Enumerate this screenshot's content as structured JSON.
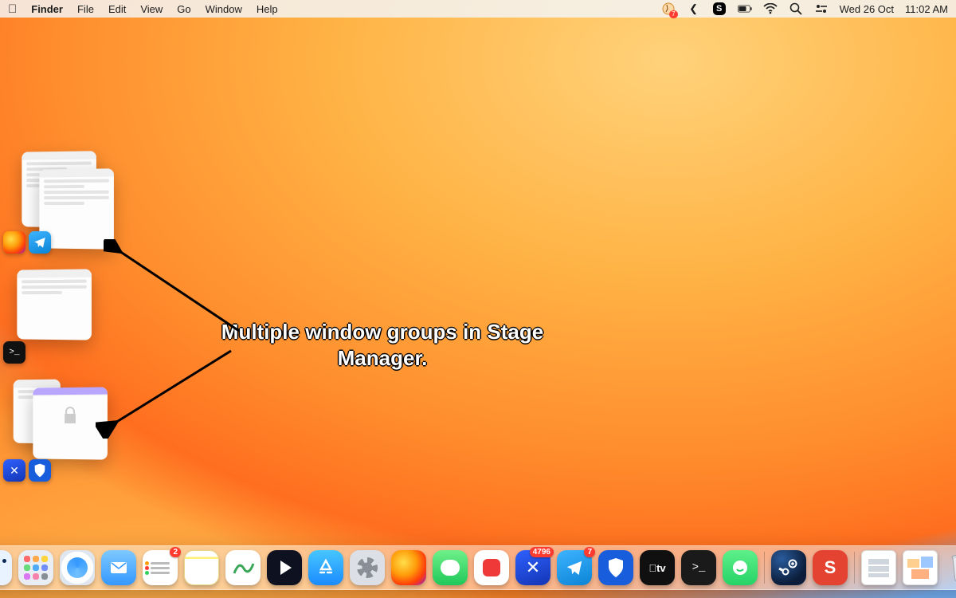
{
  "menubar": {
    "app_name": "Finder",
    "menus": [
      "File",
      "Edit",
      "View",
      "Go",
      "Window",
      "Help"
    ],
    "status": {
      "skype_badge": "S",
      "todoist_badge": "7",
      "date": "Wed 26 Oct",
      "time": "11:02 AM"
    }
  },
  "stage_manager": {
    "groups": [
      {
        "name": "group-firefox-telegram",
        "apps": [
          "Firefox",
          "Telegram"
        ]
      },
      {
        "name": "group-terminal",
        "apps": [
          "Terminal"
        ]
      },
      {
        "name": "group-tool-bitwarden",
        "apps": [
          "Tool",
          "Bitwarden"
        ]
      }
    ]
  },
  "annotation": {
    "text": "Multiple window groups in Stage Manager."
  },
  "dock": {
    "items": [
      {
        "name": "Finder",
        "class": "finder"
      },
      {
        "name": "Launchpad",
        "class": "launchpad"
      },
      {
        "name": "Safari",
        "class": "safari"
      },
      {
        "name": "Mail",
        "class": "mail"
      },
      {
        "name": "Reminders",
        "class": "reminders",
        "badge": "2"
      },
      {
        "name": "Notes",
        "class": "notes"
      },
      {
        "name": "Freeform",
        "class": "freeform"
      },
      {
        "name": "IINA",
        "class": "iina"
      },
      {
        "name": "App Store",
        "class": "appstore"
      },
      {
        "name": "System Settings",
        "class": "sysset"
      },
      {
        "name": "Firefox",
        "class": "firefox"
      },
      {
        "name": "Messages",
        "class": "messages"
      },
      {
        "name": "Vivaldi",
        "class": "vivaldi"
      },
      {
        "name": "Tool",
        "class": "tool",
        "badge": "4796"
      },
      {
        "name": "Telegram",
        "class": "telegram",
        "badge": "7"
      },
      {
        "name": "Bitwarden",
        "class": "bitwarden"
      },
      {
        "name": "Apple TV",
        "class": "appletv",
        "label": "tv"
      },
      {
        "name": "Terminal",
        "class": "terminal",
        "label": ">_"
      },
      {
        "name": "WhatsApp",
        "class": "whatsapp"
      },
      {
        "name": "Steam",
        "class": "steam"
      },
      {
        "name": "Todoist",
        "class": "todoist",
        "label": "S"
      }
    ],
    "right_items": [
      {
        "name": "Recent Folder 1",
        "class": "folder"
      },
      {
        "name": "Recent Folder 2",
        "class": "folder"
      },
      {
        "name": "Trash",
        "class": "trash"
      }
    ]
  }
}
